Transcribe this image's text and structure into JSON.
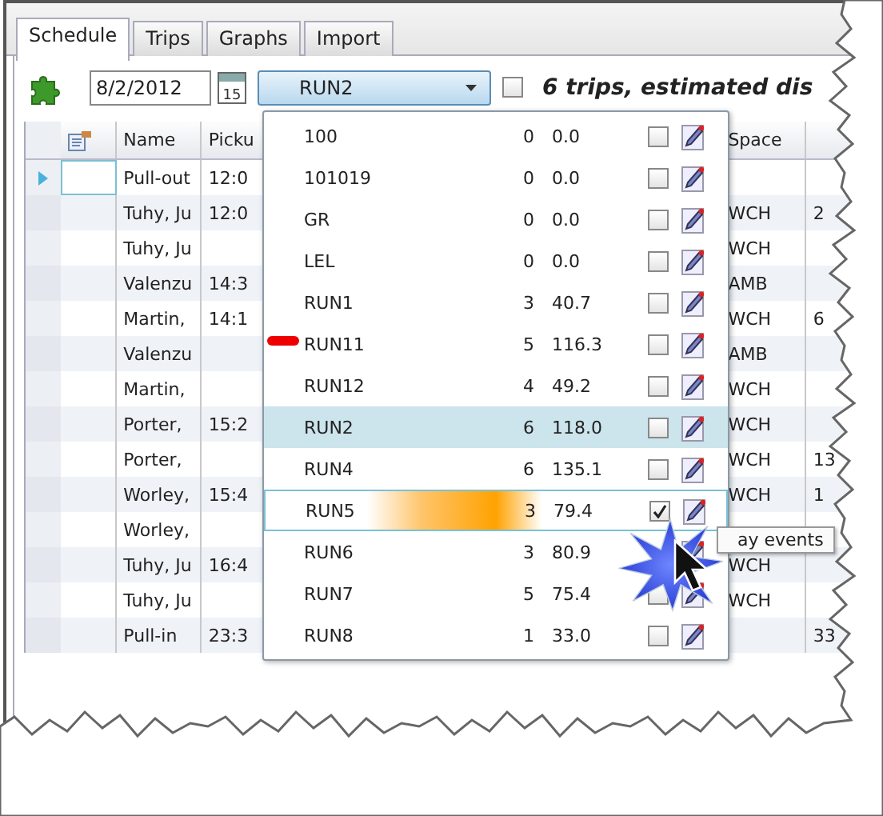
{
  "tabs": [
    {
      "label": "Schedule",
      "selected": true
    },
    {
      "label": "Trips",
      "selected": false
    },
    {
      "label": "Graphs",
      "selected": false
    },
    {
      "label": "Import",
      "selected": false
    }
  ],
  "toolbar": {
    "date": "8/2/2012",
    "calendar_day": "15",
    "run_select": "RUN2",
    "show_all_checked": false,
    "summary": "6 trips, estimated dis"
  },
  "grid": {
    "columns": [
      "Name",
      "Picku",
      "Space"
    ],
    "rows": [
      {
        "selected": true,
        "name": "Pull-out",
        "pickup": "12:0",
        "space": "",
        "column_8": ""
      },
      {
        "selected": false,
        "name": "Tuhy, Ju",
        "pickup": "12:0",
        "space": "WCH",
        "column_8": "2"
      },
      {
        "selected": false,
        "name": "Tuhy, Ju",
        "pickup": "",
        "space": "WCH",
        "column_8": ""
      },
      {
        "selected": false,
        "name": "Valenzu",
        "pickup": "14:3",
        "space": "AMB",
        "column_8": ""
      },
      {
        "selected": false,
        "name": "Martin,",
        "pickup": "14:1",
        "space": "WCH",
        "column_8": "6"
      },
      {
        "selected": false,
        "name": "Valenzu",
        "pickup": "",
        "space": "AMB",
        "column_8": ""
      },
      {
        "selected": false,
        "name": "Martin,",
        "pickup": "",
        "space": "WCH",
        "column_8": ""
      },
      {
        "selected": false,
        "name": "Porter,",
        "pickup": "15:2",
        "space": "WCH",
        "column_8": ""
      },
      {
        "selected": false,
        "name": "Porter,",
        "pickup": "",
        "space": "WCH",
        "column_8": "13"
      },
      {
        "selected": false,
        "name": "Worley,",
        "pickup": "15:4",
        "space": "WCH",
        "column_8": "1"
      },
      {
        "selected": false,
        "name": "Worley,",
        "pickup": "",
        "space": "",
        "column_8": ""
      },
      {
        "selected": false,
        "name": "Tuhy, Ju",
        "pickup": "16:4",
        "space": "WCH",
        "column_8": ""
      },
      {
        "selected": false,
        "name": "Tuhy, Ju",
        "pickup": "",
        "space": "WCH",
        "column_8": ""
      },
      {
        "selected": false,
        "name": "Pull-in",
        "pickup": "23:3",
        "space": "",
        "column_8": "33"
      }
    ]
  },
  "run_dropdown": {
    "items": [
      {
        "name": "100",
        "trips": "0",
        "distance": "0.0",
        "checked": false,
        "selected": false,
        "hovered": false,
        "flagged": false
      },
      {
        "name": "101019",
        "trips": "0",
        "distance": "0.0",
        "checked": false,
        "selected": false,
        "hovered": false,
        "flagged": false
      },
      {
        "name": "GR",
        "trips": "0",
        "distance": "0.0",
        "checked": false,
        "selected": false,
        "hovered": false,
        "flagged": false
      },
      {
        "name": "LEL",
        "trips": "0",
        "distance": "0.0",
        "checked": false,
        "selected": false,
        "hovered": false,
        "flagged": false
      },
      {
        "name": "RUN1",
        "trips": "3",
        "distance": "40.7",
        "checked": false,
        "selected": false,
        "hovered": false,
        "flagged": false
      },
      {
        "name": "RUN11",
        "trips": "5",
        "distance": "116.3",
        "checked": false,
        "selected": false,
        "hovered": false,
        "flagged": true
      },
      {
        "name": "RUN12",
        "trips": "4",
        "distance": "49.2",
        "checked": false,
        "selected": false,
        "hovered": false,
        "flagged": false
      },
      {
        "name": "RUN2",
        "trips": "6",
        "distance": "118.0",
        "checked": false,
        "selected": true,
        "hovered": false,
        "flagged": false
      },
      {
        "name": "RUN4",
        "trips": "6",
        "distance": "135.1",
        "checked": false,
        "selected": false,
        "hovered": false,
        "flagged": false
      },
      {
        "name": "RUN5",
        "trips": "3",
        "distance": "79.4",
        "checked": true,
        "selected": false,
        "hovered": true,
        "flagged": false
      },
      {
        "name": "RUN6",
        "trips": "3",
        "distance": "80.9",
        "selected": false,
        "hovered": false,
        "flagged": false
      },
      {
        "name": "RUN7",
        "trips": "5",
        "distance": "75.4",
        "checked": false,
        "selected": false,
        "hovered": false,
        "flagged": false
      },
      {
        "name": "RUN8",
        "trips": "1",
        "distance": "33.0",
        "checked": false,
        "selected": false,
        "hovered": false,
        "flagged": false
      }
    ]
  },
  "tooltip": "ay events"
}
